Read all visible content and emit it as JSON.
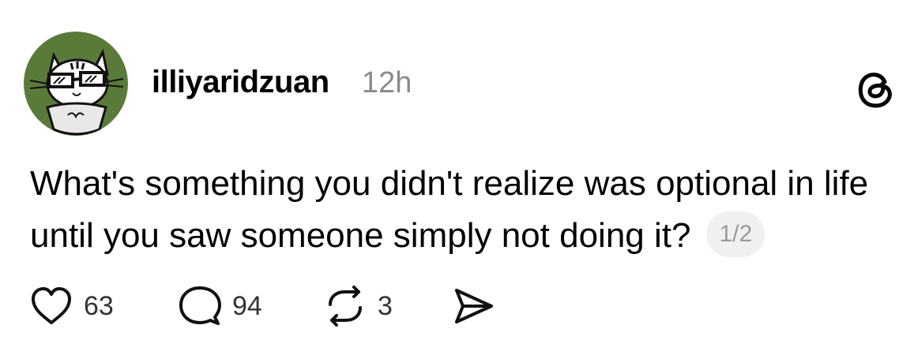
{
  "author": {
    "username": "illiyaridzuan",
    "time": "12h"
  },
  "post": {
    "text": "What's something you didn't realize was optional in life until you saw someone simply not doing it?",
    "page_indicator": "1/2"
  },
  "actions": {
    "likes": "63",
    "replies": "94",
    "reposts": "3"
  },
  "colors": {
    "avatar_bg": "#5a7a3a",
    "muted": "#8a8a8a"
  },
  "icons": {
    "like": "heart-icon",
    "reply": "comment-icon",
    "repost": "repost-icon",
    "share": "send-icon",
    "brand": "threads-logo-icon"
  }
}
